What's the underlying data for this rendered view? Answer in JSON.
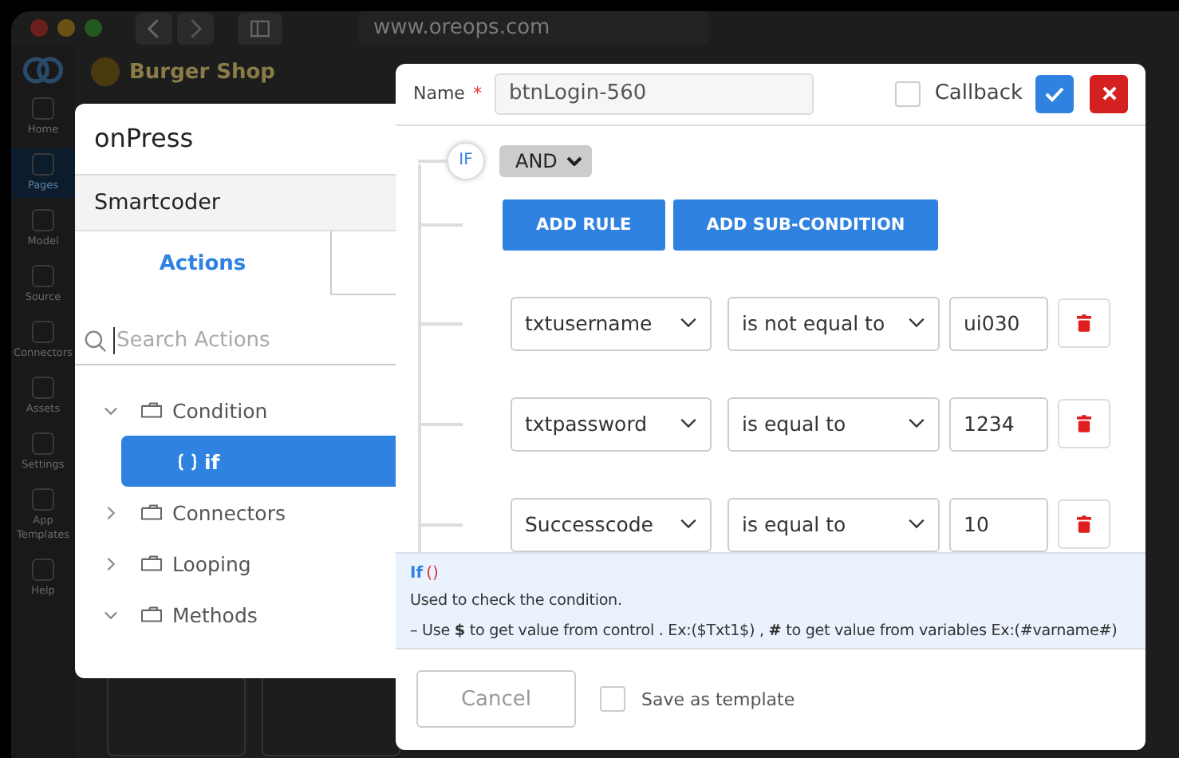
{
  "browser": {
    "url": "www.oreops.com",
    "app_title": "Burger Shop",
    "sidebar_items": [
      {
        "label": "Home",
        "selected": false
      },
      {
        "label": "Pages",
        "selected": true
      },
      {
        "label": "Model",
        "selected": false
      },
      {
        "label": "Source",
        "selected": false
      },
      {
        "label": "Connectors",
        "selected": false
      },
      {
        "label": "Assets",
        "selected": false
      },
      {
        "label": "Settings",
        "selected": false
      },
      {
        "label": "App Templates",
        "selected": false
      },
      {
        "label": "Help",
        "selected": false
      }
    ]
  },
  "actions_panel": {
    "title": "onPress",
    "section": "Smartcoder",
    "tabs": [
      {
        "label": "Actions",
        "selected": true
      }
    ],
    "search": {
      "placeholder": "Search Actions"
    },
    "tree": [
      {
        "label": "Condition",
        "expanded": true,
        "children": [
          {
            "label": "if",
            "selected": true
          }
        ]
      },
      {
        "label": "Connectors",
        "expanded": false
      },
      {
        "label": "Looping",
        "expanded": false
      },
      {
        "label": "Methods",
        "expanded": true
      }
    ]
  },
  "dialog": {
    "name_label": "Name",
    "required_mark": "*",
    "name_value": "btnLogin-560",
    "callback": {
      "label": "Callback",
      "checked": false
    },
    "condition": {
      "badge": "IF",
      "operator": "AND"
    },
    "buttons": [
      "ADD RULE",
      "ADD SUB-CONDITION"
    ],
    "rules": [
      {
        "field": "txtusername",
        "operator": "is not equal to",
        "value": "ui030"
      },
      {
        "field": "txtpassword",
        "operator": "is equal to",
        "value": "1234"
      },
      {
        "field": "Successcode",
        "operator": "is equal to",
        "value": "10"
      }
    ],
    "help": {
      "title": "If",
      "parens": "()",
      "description": "Used to check the condition.",
      "usage": "– Use **$** to get value from control . Ex:($Txt1$) , **#** to get value from variables Ex:(#varname#)"
    },
    "footer": {
      "cancel": "Cancel",
      "save_template": {
        "label": "Save as template",
        "checked": false
      }
    }
  }
}
